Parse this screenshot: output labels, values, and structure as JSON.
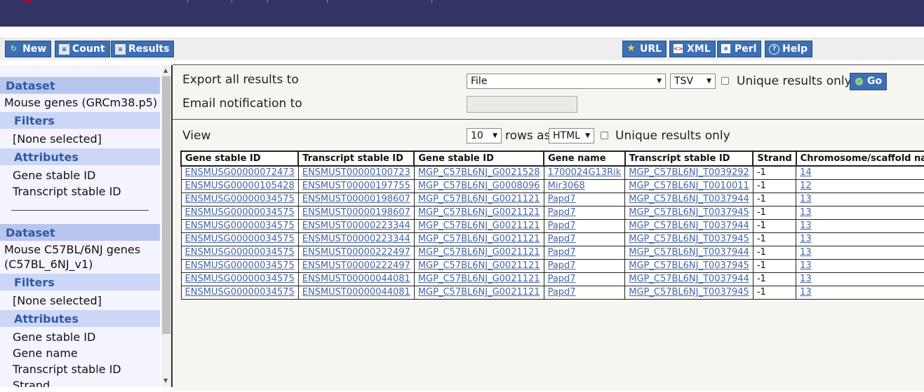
{
  "toolbar": {
    "left_buttons": [
      {
        "label": "New",
        "icon": "new-icon"
      },
      {
        "label": "Count",
        "icon": "count-icon"
      },
      {
        "label": "Results",
        "icon": "results-icon"
      }
    ],
    "right_buttons": [
      {
        "label": "URL",
        "icon": "star-icon"
      },
      {
        "label": "XML",
        "icon": "xml-icon"
      },
      {
        "label": "Perl",
        "icon": "perl-icon"
      },
      {
        "label": "Help",
        "icon": "help-icon"
      }
    ]
  },
  "sidebar": {
    "datasets": [
      {
        "heading": "Dataset",
        "name": "Mouse genes (GRCm38.p5)",
        "filters_heading": "Filters",
        "filters": [
          "[None selected]"
        ],
        "attributes_heading": "Attributes",
        "attributes": [
          "Gene stable ID",
          "Transcript stable ID"
        ]
      },
      {
        "heading": "Dataset",
        "name_line1": "Mouse C57BL/6NJ genes",
        "name_line2": "(C57BL_6NJ_v1)",
        "filters_heading": "Filters",
        "filters": [
          "[None selected]"
        ],
        "attributes_heading": "Attributes",
        "attributes": [
          "Gene stable ID",
          "Gene name",
          "Transcript stable ID",
          "Strand"
        ]
      }
    ]
  },
  "export": {
    "label": "Export  all results to",
    "destination": "File",
    "format": "TSV",
    "unique_label": "Unique results only",
    "go_label": "Go",
    "email_label": "Email notification to",
    "email_value": ""
  },
  "view": {
    "label": "View",
    "rows": "10",
    "rows_as_label": "rows as",
    "format": "HTML",
    "unique_label": "Unique results only"
  },
  "table": {
    "headers": [
      "Gene stable ID",
      "Transcript stable ID",
      "Gene stable ID",
      "Gene name",
      "Transcript stable ID",
      "Strand",
      "Chromosome/scaffold name"
    ],
    "rows": [
      [
        "ENSMUSG00000072473",
        "ENSMUST00000100723",
        "MGP_C57BL6NJ_G0021528",
        "1700024G13Rik",
        "MGP_C57BL6NJ_T0039292",
        "-1",
        "14"
      ],
      [
        "ENSMUSG00000105428",
        "ENSMUST00000197755",
        "MGP_C57BL6NJ_G0008096",
        "Mir3068",
        "MGP_C57BL6NJ_T0010011",
        "-1",
        "12"
      ],
      [
        "ENSMUSG00000034575",
        "ENSMUST00000198607",
        "MGP_C57BL6NJ_G0021121",
        "Papd7",
        "MGP_C57BL6NJ_T0037944",
        "-1",
        "13"
      ],
      [
        "ENSMUSG00000034575",
        "ENSMUST00000198607",
        "MGP_C57BL6NJ_G0021121",
        "Papd7",
        "MGP_C57BL6NJ_T0037945",
        "-1",
        "13"
      ],
      [
        "ENSMUSG00000034575",
        "ENSMUST00000223344",
        "MGP_C57BL6NJ_G0021121",
        "Papd7",
        "MGP_C57BL6NJ_T0037944",
        "-1",
        "13"
      ],
      [
        "ENSMUSG00000034575",
        "ENSMUST00000223344",
        "MGP_C57BL6NJ_G0021121",
        "Papd7",
        "MGP_C57BL6NJ_T0037945",
        "-1",
        "13"
      ],
      [
        "ENSMUSG00000034575",
        "ENSMUST00000222497",
        "MGP_C57BL6NJ_G0021121",
        "Papd7",
        "MGP_C57BL6NJ_T0037944",
        "-1",
        "13"
      ],
      [
        "ENSMUSG00000034575",
        "ENSMUST00000222497",
        "MGP_C57BL6NJ_G0021121",
        "Papd7",
        "MGP_C57BL6NJ_T0037945",
        "-1",
        "13"
      ],
      [
        "ENSMUSG00000034575",
        "ENSMUST00000044081",
        "MGP_C57BL6NJ_G0021121",
        "Papd7",
        "MGP_C57BL6NJ_T0037944",
        "-1",
        "13"
      ],
      [
        "ENSMUSG00000034575",
        "ENSMUST00000044081",
        "MGP_C57BL6NJ_G0021121",
        "Papd7",
        "MGP_C57BL6NJ_T0037945",
        "-1",
        "13"
      ]
    ]
  },
  "colors": {
    "header_band": "#333366",
    "button_blue": "#3d6fb4",
    "sidebar_heading": "#b8c6ee",
    "link": "#4466aa"
  }
}
